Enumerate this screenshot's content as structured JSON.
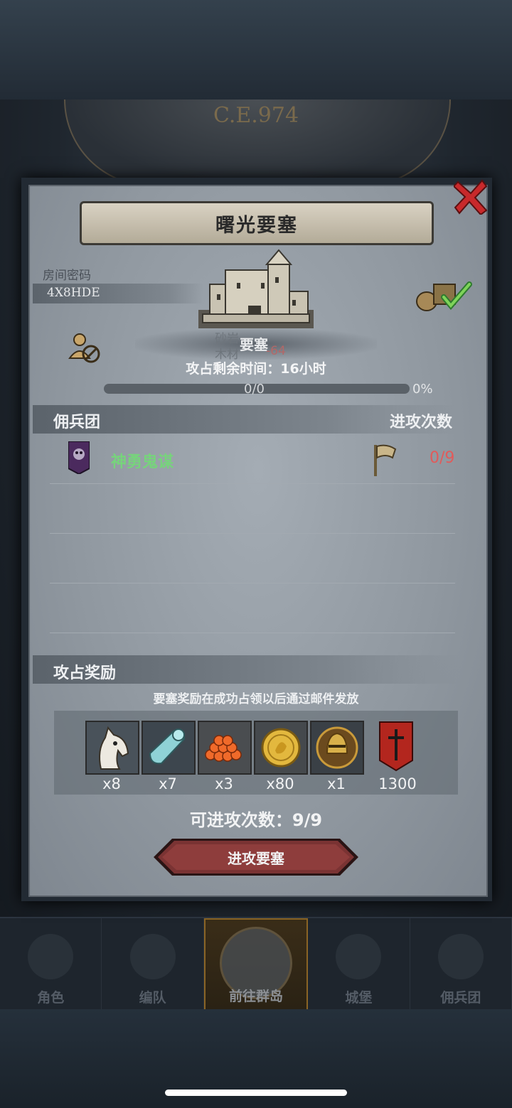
{
  "background": {
    "era_label": "C.E.974"
  },
  "dialog": {
    "title": "曙光要塞",
    "room": {
      "label": "房间密码",
      "code": "4X8HDE"
    },
    "fortress": {
      "type_label": "要塞",
      "resource_1": "砂岩",
      "resource_2": "木材",
      "resource_2_value": "-64"
    },
    "remaining_time": "攻占剩余时间：16小时",
    "progress": {
      "text": "0/0",
      "percent_label": "0%",
      "percent": 0
    },
    "mercenary_section": {
      "title": "佣兵团",
      "count_header": "进攻次数",
      "rows": [
        {
          "name": "神勇鬼谋",
          "attacks": "0/9"
        }
      ]
    },
    "reward_section": {
      "title": "攻占奖励",
      "note": "要塞奖励在成功占领以后通过邮件发放",
      "items": [
        {
          "icon": "horse-icon",
          "qty": "x8"
        },
        {
          "icon": "cloth-roll-icon",
          "qty": "x7"
        },
        {
          "icon": "food-pile-icon",
          "qty": "x3"
        },
        {
          "icon": "gold-coin-icon",
          "qty": "x80"
        },
        {
          "icon": "helmet-medal-icon",
          "qty": "x1"
        },
        {
          "icon": "sword-banner-icon",
          "qty": "1300"
        }
      ]
    },
    "attempts_left": "可进攻次数：9/9",
    "attack_button": "进攻要塞"
  },
  "nav": {
    "items": [
      {
        "label": "角色",
        "active": false
      },
      {
        "label": "编队",
        "active": false
      },
      {
        "label": "前往群岛",
        "active": true
      },
      {
        "label": "城堡",
        "active": false
      },
      {
        "label": "佣兵团",
        "active": false
      }
    ]
  },
  "colors": {
    "merc_name": "#77d37c",
    "attack_count": "#e25a5a",
    "close_x": "#c8292b",
    "attack_button": "#7a3333"
  }
}
